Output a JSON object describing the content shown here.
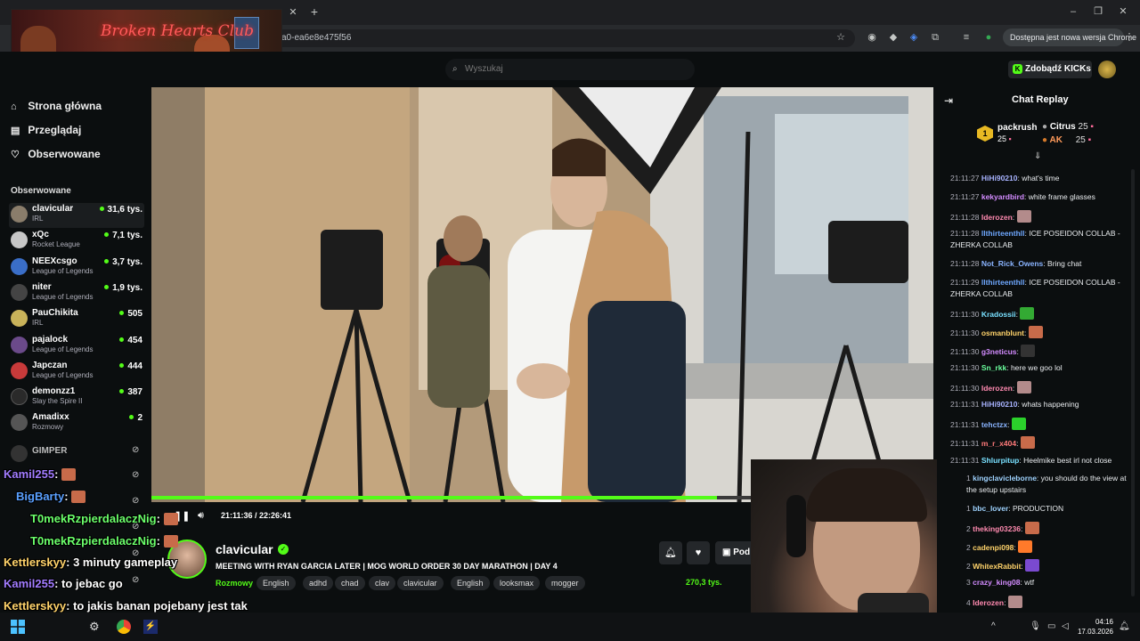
{
  "browser": {
    "url_fragment": "a0-ea6e8e475f56",
    "update_label": "Dostępna jest nowa wersja Chrome"
  },
  "overlay_banner": {
    "title": "Broken Hearts Club"
  },
  "topnav": {
    "search_placeholder": "Wyszukaj",
    "kicks_label": "Zdobądź KICKs"
  },
  "sidebar": {
    "nav": [
      {
        "label": "Strona główna",
        "icon": "home-icon"
      },
      {
        "label": "Przeglądaj",
        "icon": "browse-icon"
      },
      {
        "label": "Obserwowane",
        "icon": "heart-icon"
      }
    ],
    "followed_heading": "Obserwowane",
    "channels": [
      {
        "name": "clavicular",
        "category": "IRL",
        "viewers": "31,6 tys.",
        "color": "#8a7d6b"
      },
      {
        "name": "xQc",
        "category": "Rocket League",
        "viewers": "7,1 tys.",
        "color": "#c7c7c7"
      },
      {
        "name": "NEEXcsgo",
        "category": "League of Legends",
        "viewers": "3,7 tys.",
        "color": "#3a6ec8"
      },
      {
        "name": "niter",
        "category": "League of Legends",
        "viewers": "1,9 tys.",
        "color": "#444"
      },
      {
        "name": "PauChikita",
        "category": "IRL",
        "viewers": "505",
        "color": "#c9b35a"
      },
      {
        "name": "pajalock",
        "category": "League of Legends",
        "viewers": "454",
        "color": "#6b4a8a"
      },
      {
        "name": "Japczan",
        "category": "League of Legends",
        "viewers": "444",
        "color": "#c83a3a"
      },
      {
        "name": "demonzz1",
        "category": "Slay the Spire II",
        "viewers": "387",
        "color": "#2a2a2a"
      },
      {
        "name": "Amadixx",
        "category": "Rozmowy",
        "viewers": "2",
        "color": "#555"
      },
      {
        "name": "GIMPER",
        "category": "",
        "viewers": "",
        "color": "#333"
      }
    ]
  },
  "player": {
    "time": "21:11:36 / 22:26:41",
    "progress": 0.944
  },
  "stream": {
    "streamer": "clavicular",
    "title": "MEETING WITH RYAN GARCIA LATER | MOG WORLD ORDER 30 DAY MARATHON | DAY 4",
    "category": "Rozmowy",
    "tags": [
      "English",
      "adhd",
      "chad",
      "clav",
      "clavicular",
      "English",
      "looksmax",
      "mogger"
    ],
    "viewers": "270,3 tys.",
    "sub_label": "Pod"
  },
  "chat": {
    "title": "Chat Replay",
    "gifters": [
      {
        "rank": "1",
        "name": "packrush",
        "count": "25"
      },
      {
        "name": "Citrus",
        "count": "25"
      },
      {
        "name": "AK",
        "count": "25"
      }
    ],
    "messages": [
      {
        "ts": "21:11:27",
        "user": "HiHi90210",
        "color": "#a8b3ff",
        "text": "what's time"
      },
      {
        "ts": "21:11:27",
        "user": "kekyardbird",
        "color": "#d38cff",
        "text": "white frame glasses"
      },
      {
        "ts": "21:11:28",
        "user": "Iderozen",
        "color": "#ff8ab0",
        "text": ""
      },
      {
        "ts": "21:11:28",
        "user": "llthirteenthll",
        "color": "#6fa8ff",
        "text": "ICE POSEIDON COLLAB - ZHERKA COLLAB"
      },
      {
        "ts": "21:11:28",
        "user": "Not_Rick_Owens",
        "color": "#8ab4ff",
        "text": "Bring chat"
      },
      {
        "ts": "21:11:29",
        "user": "llthirteenthll",
        "color": "#6fa8ff",
        "text": "ICE POSEIDON COLLAB - ZHERKA COLLAB"
      },
      {
        "ts": "21:11:30",
        "user": "Kradossii",
        "color": "#79e0ff",
        "text": ""
      },
      {
        "ts": "21:11:30",
        "user": "osmanblunt",
        "color": "#ffd36b",
        "text": ""
      },
      {
        "ts": "21:11:30",
        "user": "g3neticus",
        "color": "#d38cff",
        "text": ""
      },
      {
        "ts": "21:11:30",
        "user": "Sn_rkk",
        "color": "#6bff9e",
        "text": "here we goo lol"
      },
      {
        "ts": "21:11:30",
        "user": "Iderozen",
        "color": "#ff8ab0",
        "text": ""
      },
      {
        "ts": "21:11:31",
        "user": "HiHi90210",
        "color": "#a8b3ff",
        "text": "whats happening"
      },
      {
        "ts": "21:11:31",
        "user": "tehctzx",
        "color": "#8ab4ff",
        "text": ""
      },
      {
        "ts": "21:11:31",
        "user": "m_r_x404",
        "color": "#ff7a7a",
        "text": ""
      },
      {
        "ts": "21:11:31",
        "user": "Shlurpitup",
        "color": "#79e0ff",
        "text": "Heelmike best irl not close"
      },
      {
        "ts": "1",
        "user": "kingclavicleborne",
        "color": "#9fd3ff",
        "text": "you should do the view at the setup upstairs"
      },
      {
        "ts": "1",
        "user": "bbc_lover",
        "color": "#9fd3ff",
        "text": "PRODUCTION"
      },
      {
        "ts": "2",
        "user": "theking03236",
        "color": "#ff8ab0",
        "text": ""
      },
      {
        "ts": "2",
        "user": "cadenpi098",
        "color": "#ffd36b",
        "text": ""
      },
      {
        "ts": "2",
        "user": "WhitexRabbit",
        "color": "#ffd36b",
        "text": ""
      },
      {
        "ts": "3",
        "user": "crazy_king08",
        "color": "#d38cff",
        "text": "wtf"
      },
      {
        "ts": "4",
        "user": "Iderozen",
        "color": "#ff8ab0",
        "text": ""
      }
    ]
  },
  "overlay_chat": [
    {
      "user": "Kamil255",
      "color": "#a27cff",
      "text": ""
    },
    {
      "user": "BigBarty",
      "color": "#5aa0ff",
      "text": ""
    },
    {
      "user": "T0mekRzpierdalaczNig",
      "color": "#6bff6b",
      "text": ""
    },
    {
      "user": "T0mekRzpierdalaczNig",
      "color": "#6bff6b",
      "text": ""
    },
    {
      "user": "Kettlerskyy",
      "color": "#ffd36b",
      "text": "3 minuty gameplay"
    },
    {
      "user": "Kamil255",
      "color": "#a27cff",
      "text": "to jebac go"
    },
    {
      "user": "Kettlerskyy",
      "color": "#ffd36b",
      "text": "to jakis banan pojebany jest tak"
    },
    {
      "user": "Kettlerskyy",
      "color": "#ffd36b",
      "text": ""
    }
  ],
  "taskbar": {
    "time": "04:16",
    "date": "17.03.2026"
  }
}
